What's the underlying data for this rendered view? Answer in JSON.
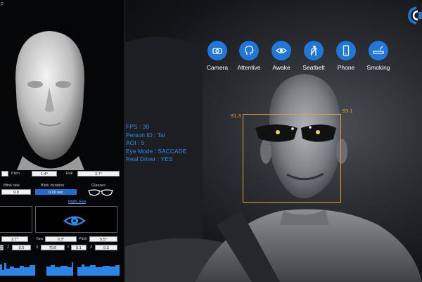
{
  "app": {
    "title_fragment": "p"
  },
  "left_panel": {
    "pose_labels": [
      "Pitch",
      "Roll"
    ],
    "pose_values": [
      "1.4°",
      "2.7°"
    ],
    "blink_rate_label": "Blink rate",
    "blink_rate_value": "9.0",
    "blink_duration_label": "Blink duration",
    "blink_duration_value": "0.00 sec",
    "glasses_label": "Glasses",
    "right_eye_label": "Right_Eye",
    "left_bottom_value": "2.7°",
    "eye_values": {
      "yaw_label": "Yaw",
      "yaw_value": "0.3°",
      "pitch_label": "Pitch",
      "pitch_value": "5.5°"
    },
    "coords_left": {
      "z_label": "Z",
      "z_value": "0.0"
    },
    "coords_right": {
      "x_label": "X",
      "x_value": "70.0",
      "y_label": "Y",
      "y_value": "5.1",
      "z_label": "Z",
      "z_value": "0.3"
    },
    "left_partial_value": "2"
  },
  "monitors": [
    {
      "label": "Camera",
      "icon": "camera-icon"
    },
    {
      "label": "Attentive",
      "icon": "head-profile-icon"
    },
    {
      "label": "Awake",
      "icon": "eye-icon"
    },
    {
      "label": "Seatbelt",
      "icon": "seatbelt-icon"
    },
    {
      "label": "Phone",
      "icon": "phone-icon"
    },
    {
      "label": "Smoking",
      "icon": "cigarette-icon"
    }
  ],
  "info": {
    "fps": "FPS : 30",
    "person_id": "Person ID : Tal",
    "aoi": "AOI : 5",
    "eye_mode": "Eye Mode : SACCADE",
    "real_driver": "Real Driver : YES"
  },
  "face_box": {
    "left_value": "91.3",
    "right_value": "93.1"
  },
  "colors": {
    "accent": "#1f78d8",
    "text_accent": "#2e8de8",
    "face_box": "#e3a33a"
  }
}
